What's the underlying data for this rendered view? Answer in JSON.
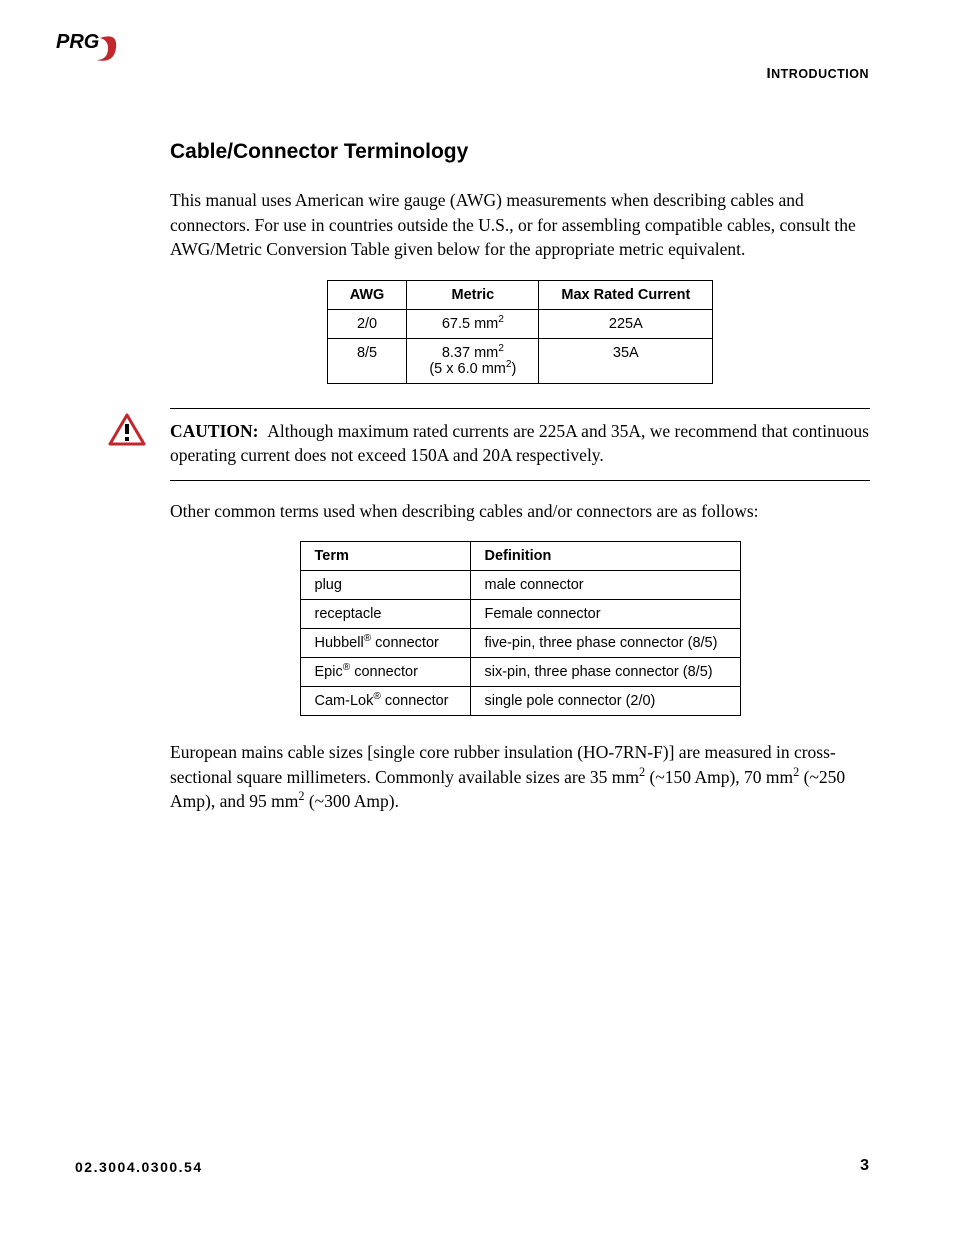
{
  "header": {
    "section_label": "INTRODUCTION"
  },
  "section": {
    "title": "Cable/Connector Terminology",
    "intro": "This manual uses American wire gauge (AWG) measurements when describing cables and connectors. For use in countries outside the U.S., or for assembling compatible cables, consult the AWG/Metric Conversion Table given below for the appropriate metric equivalent."
  },
  "awg_table": {
    "headers": {
      "awg": "AWG",
      "metric": "Metric",
      "max": "Max Rated Current"
    },
    "rows": [
      {
        "awg": "2/0",
        "metric_val": "67.5 mm",
        "metric_sup": "2",
        "metric_extra": "",
        "max": "225A"
      },
      {
        "awg": "8/5",
        "metric_val": "8.37 mm",
        "metric_sup": "2",
        "metric_extra_pre": "(5 x 6.0 mm",
        "metric_extra_sup": "2",
        "metric_extra_post": ")",
        "max": "35A"
      }
    ]
  },
  "caution": {
    "label": "CAUTION:",
    "text": "Although maximum rated currents are 225A and 35A, we recommend that continuous operating current does not exceed 150A and 20A respectively."
  },
  "terms_intro": "Other common terms used when describing cables and/or connectors are as follows:",
  "terms_table": {
    "headers": {
      "term": "Term",
      "def": "Definition"
    },
    "rows": [
      {
        "term_pre": "plug",
        "term_sup": "",
        "term_post": "",
        "def": "male connector"
      },
      {
        "term_pre": "receptacle",
        "term_sup": "",
        "term_post": "",
        "def": "Female connector"
      },
      {
        "term_pre": "Hubbell",
        "term_sup": "®",
        "term_post": " connector",
        "def": "five-pin, three phase connector (8/5)"
      },
      {
        "term_pre": "Epic",
        "term_sup": "®",
        "term_post": " connector",
        "def": "six-pin, three phase connector (8/5)"
      },
      {
        "term_pre": "Cam-Lok",
        "term_sup": "®",
        "term_post": " connector",
        "def": "single pole connector (2/0)"
      }
    ]
  },
  "euro": {
    "p1": "European mains cable sizes [single core rubber insulation (HO-7RN-F)] are measured in cross-sectional square millimeters. Commonly available sizes are 35 mm",
    "s1": "2",
    "p2": " (~150 Amp), 70 mm",
    "s2": "2",
    "p3": " (~250 Amp), and 95 mm",
    "s3": "2",
    "p4": " (~300 Amp)."
  },
  "footer": {
    "doc_id": "02.3004.0300.54",
    "page": "3"
  }
}
